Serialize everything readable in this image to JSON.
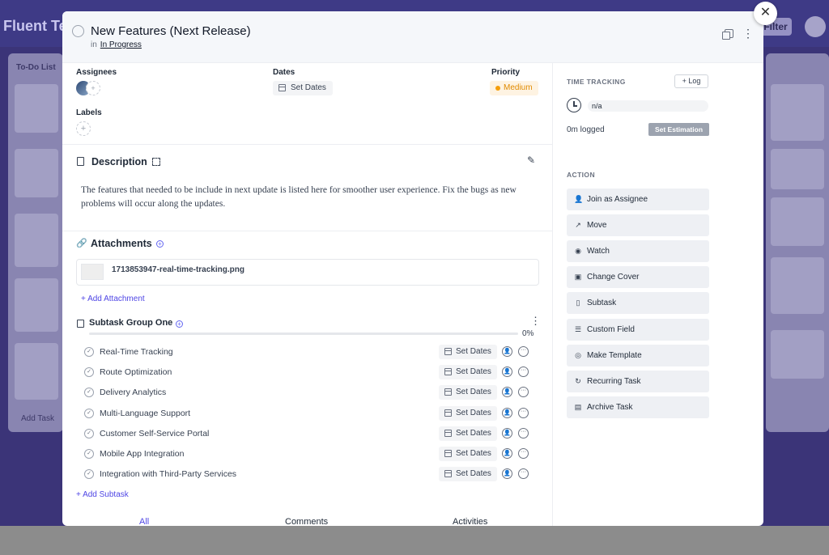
{
  "background": {
    "app_title": "Fluent Team",
    "filter_label": "Filter",
    "list_title": "To-Do List",
    "add_task_label": "Add Task"
  },
  "modal": {
    "close_icon": "close-icon",
    "title": "New Features (Next Release)",
    "in_label": "in",
    "status_link": "In Progress",
    "fields": {
      "assignees_label": "Assignees",
      "dates_label": "Dates",
      "dates_value": "Set Dates",
      "priority_label": "Priority",
      "priority_value": "Medium",
      "priority_color": "#f59e0b",
      "labels_label": "Labels"
    },
    "description": {
      "title": "Description",
      "text": "The features that needed to be include in next update is listed here for smoother user experience. Fix the bugs as new problems will occur along the updates."
    },
    "attachments": {
      "title": "Attachments",
      "file_name": "1713853947-real-time-tracking.png",
      "add_label": "+ Add Attachment"
    },
    "subtask_group": {
      "title": "Subtask Group One",
      "progress_percent": 0,
      "progress_label": "0%",
      "items": [
        {
          "label": "Real-Time Tracking",
          "dates": "Set Dates"
        },
        {
          "label": "Route Optimization",
          "dates": "Set Dates"
        },
        {
          "label": "Delivery Analytics",
          "dates": "Set Dates"
        },
        {
          "label": "Multi-Language Support",
          "dates": "Set Dates"
        },
        {
          "label": "Customer Self-Service Portal",
          "dates": "Set Dates"
        },
        {
          "label": "Mobile App Integration",
          "dates": "Set Dates"
        },
        {
          "label": "Integration with Third-Party Services",
          "dates": "Set Dates"
        }
      ],
      "add_label": "+ Add Subtask"
    },
    "tabs": [
      "All",
      "Comments",
      "Activities"
    ],
    "active_tab": "All",
    "accent_color": "#4f46e5"
  },
  "sidebar": {
    "time_tracking_label": "TIME TRACKING",
    "log_label": "+ Log",
    "estimate_value": "n/a",
    "logged_text": "0m logged",
    "set_estimation_label": "Set Estimation",
    "action_label": "ACTION",
    "actions": [
      {
        "label": "Join as Assignee",
        "icon": "user-icon"
      },
      {
        "label": "Move",
        "icon": "arrow-icon"
      },
      {
        "label": "Watch",
        "icon": "eye-icon"
      },
      {
        "label": "Change Cover",
        "icon": "image-icon"
      },
      {
        "label": "Subtask",
        "icon": "subtask-icon"
      },
      {
        "label": "Custom Field",
        "icon": "list-icon"
      },
      {
        "label": "Make Template",
        "icon": "template-icon"
      },
      {
        "label": "Recurring Task",
        "icon": "refresh-icon"
      },
      {
        "label": "Archive Task",
        "icon": "archive-icon"
      }
    ]
  }
}
